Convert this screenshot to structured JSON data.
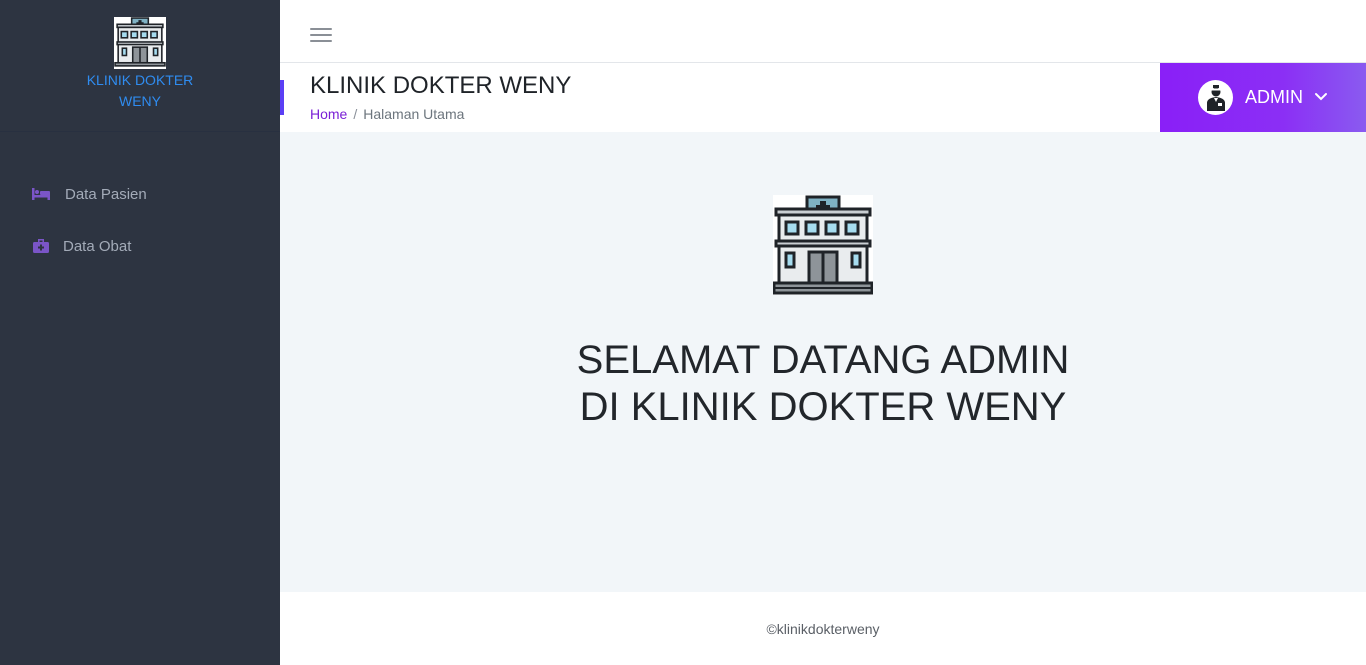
{
  "brand": {
    "name": "KLINIK DOKTER WENY",
    "logo_icon": "hospital-building-icon"
  },
  "sidebar": {
    "items": [
      {
        "label": "Data Pasien",
        "icon": "bed-icon"
      },
      {
        "label": "Data Obat",
        "icon": "medical-kit-icon"
      }
    ]
  },
  "topbar": {
    "menu_icon": "hamburger-menu-icon"
  },
  "header": {
    "title": "KLINIK DOKTER WENY",
    "breadcrumb": {
      "home": "Home",
      "separator": "/",
      "current": "Halaman Utama"
    }
  },
  "user": {
    "name": "ADMIN",
    "avatar_icon": "doctor-avatar-icon",
    "dropdown_icon": "chevron-down-icon"
  },
  "main": {
    "hero_icon": "hospital-building-icon",
    "welcome_line1": "SELAMAT DATANG ADMIN",
    "welcome_line2": "DI KLINIK DOKTER WENY"
  },
  "footer": {
    "text": "©klinikdokterweny"
  },
  "colors": {
    "sidebar_bg": "#2d3441",
    "brand_text": "#2f8cf0",
    "accent": "#8a1ff7",
    "menu_icon": "#7a55c7",
    "content_bg": "#f2f6f9"
  }
}
